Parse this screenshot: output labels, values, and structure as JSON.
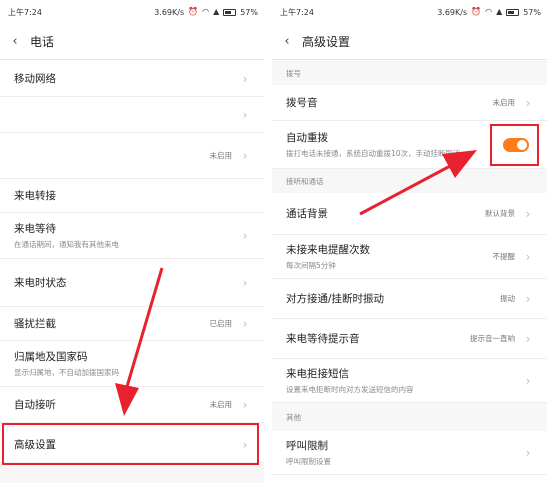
{
  "left": {
    "status": {
      "time": "上午7:24",
      "speed": "3.69K/s",
      "battery": "57%"
    },
    "title": "电话",
    "rows": [
      {
        "label": "移动网络",
        "sub": "",
        "value": ""
      },
      {
        "label": "来电转接",
        "sub": "",
        "value": ""
      },
      {
        "label": "来电等待",
        "sub": "在通话期间，通知我有其他来电",
        "value": ""
      },
      {
        "label": "来电时状态",
        "sub": "",
        "value": ""
      },
      {
        "label": "骚扰拦截",
        "sub": "",
        "value": "已启用"
      },
      {
        "label": "归属地及国家码",
        "sub": "显示归属地，不自动加拨国家码",
        "value": ""
      },
      {
        "label": "自动接听",
        "sub": "",
        "value": "未启用"
      },
      {
        "label": "高级设置",
        "sub": "",
        "value": ""
      }
    ],
    "extra_value": "未启用"
  },
  "right": {
    "status": {
      "time": "上午7:24",
      "speed": "3.69K/s",
      "battery": "57%"
    },
    "title": "高级设置",
    "sections": {
      "dial": "拨号",
      "calls": "接听和通话",
      "other": "其他"
    },
    "rows": [
      {
        "label": "拨号音",
        "sub": "",
        "value": "未启用"
      },
      {
        "label": "自动重拨",
        "sub": "拨打电话未接通，系统自动重拨10次，手动挂断取消",
        "value": ""
      },
      {
        "label": "通话背景",
        "sub": "",
        "value": "默认背景"
      },
      {
        "label": "未接来电提醒次数",
        "sub": "每次间隔5分钟",
        "value": "不提醒"
      },
      {
        "label": "对方接通/挂断时振动",
        "sub": "",
        "value": "振动"
      },
      {
        "label": "来电等待提示音",
        "sub": "",
        "value": "提示音一直响"
      },
      {
        "label": "来电拒接短信",
        "sub": "设置来电拒断时向对方发送短信的内容",
        "value": ""
      },
      {
        "label": "呼叫限制",
        "sub": "呼叫限制设置",
        "value": ""
      }
    ],
    "auto_redial_on": true
  },
  "colors": {
    "accent": "#ff7a1a",
    "highlight": "#e8212f"
  }
}
